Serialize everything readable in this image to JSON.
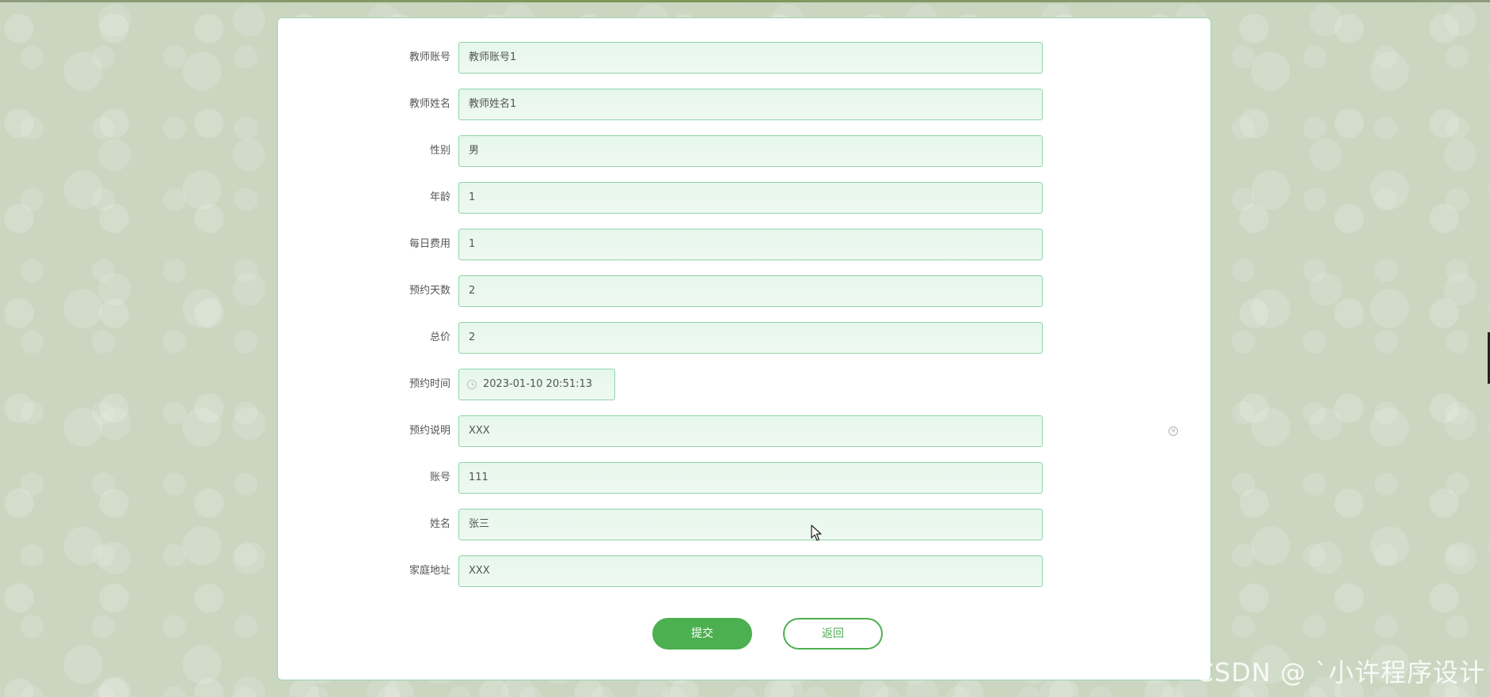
{
  "form": {
    "fields": [
      {
        "label": "教师账号",
        "value": "教师账号1"
      },
      {
        "label": "教师姓名",
        "value": "教师姓名1"
      },
      {
        "label": "性别",
        "value": "男"
      },
      {
        "label": "年龄",
        "value": "1"
      },
      {
        "label": "每日费用",
        "value": "1"
      },
      {
        "label": "预约天数",
        "value": "2"
      },
      {
        "label": "总价",
        "value": "2"
      },
      {
        "label": "预约时间",
        "value": "2023-01-10 20:51:13"
      },
      {
        "label": "预约说明",
        "value": "XXX"
      },
      {
        "label": "账号",
        "value": "111"
      },
      {
        "label": "姓名",
        "value": "张三"
      },
      {
        "label": "家庭地址",
        "value": "XXX"
      }
    ],
    "submit_label": "提交",
    "back_label": "返回"
  },
  "icons": {
    "clock": "clock-icon",
    "clear": "clear-circle-icon",
    "cursor": "mouse-cursor-icon"
  },
  "colors": {
    "accent": "#4caf50",
    "input_border": "#8fd4aa",
    "input_bg": "#e6f7ec"
  },
  "watermark": "CSDN @ `小许程序设计"
}
